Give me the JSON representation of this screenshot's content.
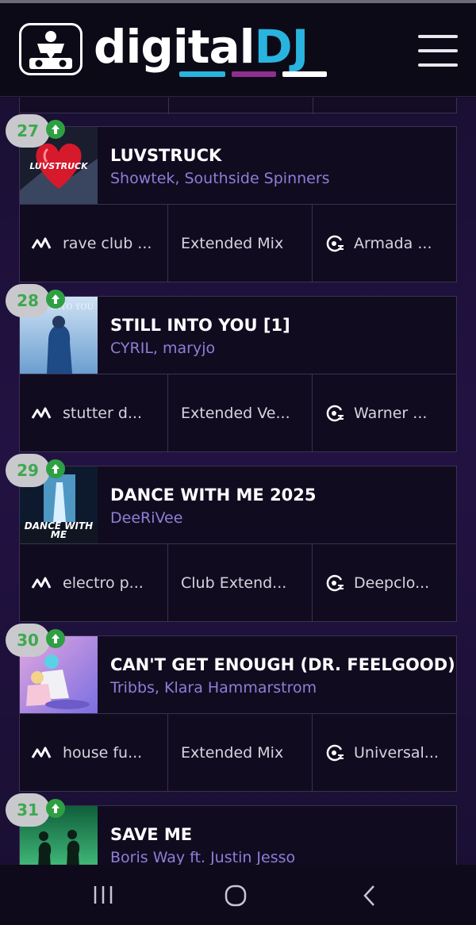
{
  "header": {
    "logo_text_a": "digital",
    "logo_text_b": "DJ",
    "colors": {
      "bar1": "#29b4df",
      "bar2": "#8e2f8e",
      "bar3": "#ffffff"
    }
  },
  "tracks": [
    {
      "rank": "27",
      "title": "LUVSTRUCK",
      "artists": "Showtek, Southside Spinners",
      "cover_text": "LUVSTRUCK",
      "genre": "rave club ...",
      "mix": "Extended Mix",
      "label": "Armada ..."
    },
    {
      "rank": "28",
      "title": "STILL INTO YOU [1]",
      "artists": "CYRIL, maryjo",
      "cover_text": "STILL INTO YOU",
      "genre": "stutter d...",
      "mix": "Extended Ve...",
      "label": "Warner ..."
    },
    {
      "rank": "29",
      "title": "DANCE WITH ME 2025",
      "artists": "DeeRiVee",
      "cover_text": "DANCE WITH ME",
      "genre": "electro p...",
      "mix": "Club Extend...",
      "label": "Deepclo..."
    },
    {
      "rank": "30",
      "title": "CAN'T GET ENOUGH (DR. FEELGOOD)",
      "artists": "Tribbs, Klara Hammarstrom",
      "cover_text": "",
      "genre": "house fu...",
      "mix": "Extended Mix",
      "label": "Universal..."
    },
    {
      "rank": "31",
      "title": "SAVE ME",
      "artists": "Boris Way ft. Justin Jesso",
      "cover_text": "",
      "genre": "",
      "mix": "",
      "label": ""
    }
  ]
}
